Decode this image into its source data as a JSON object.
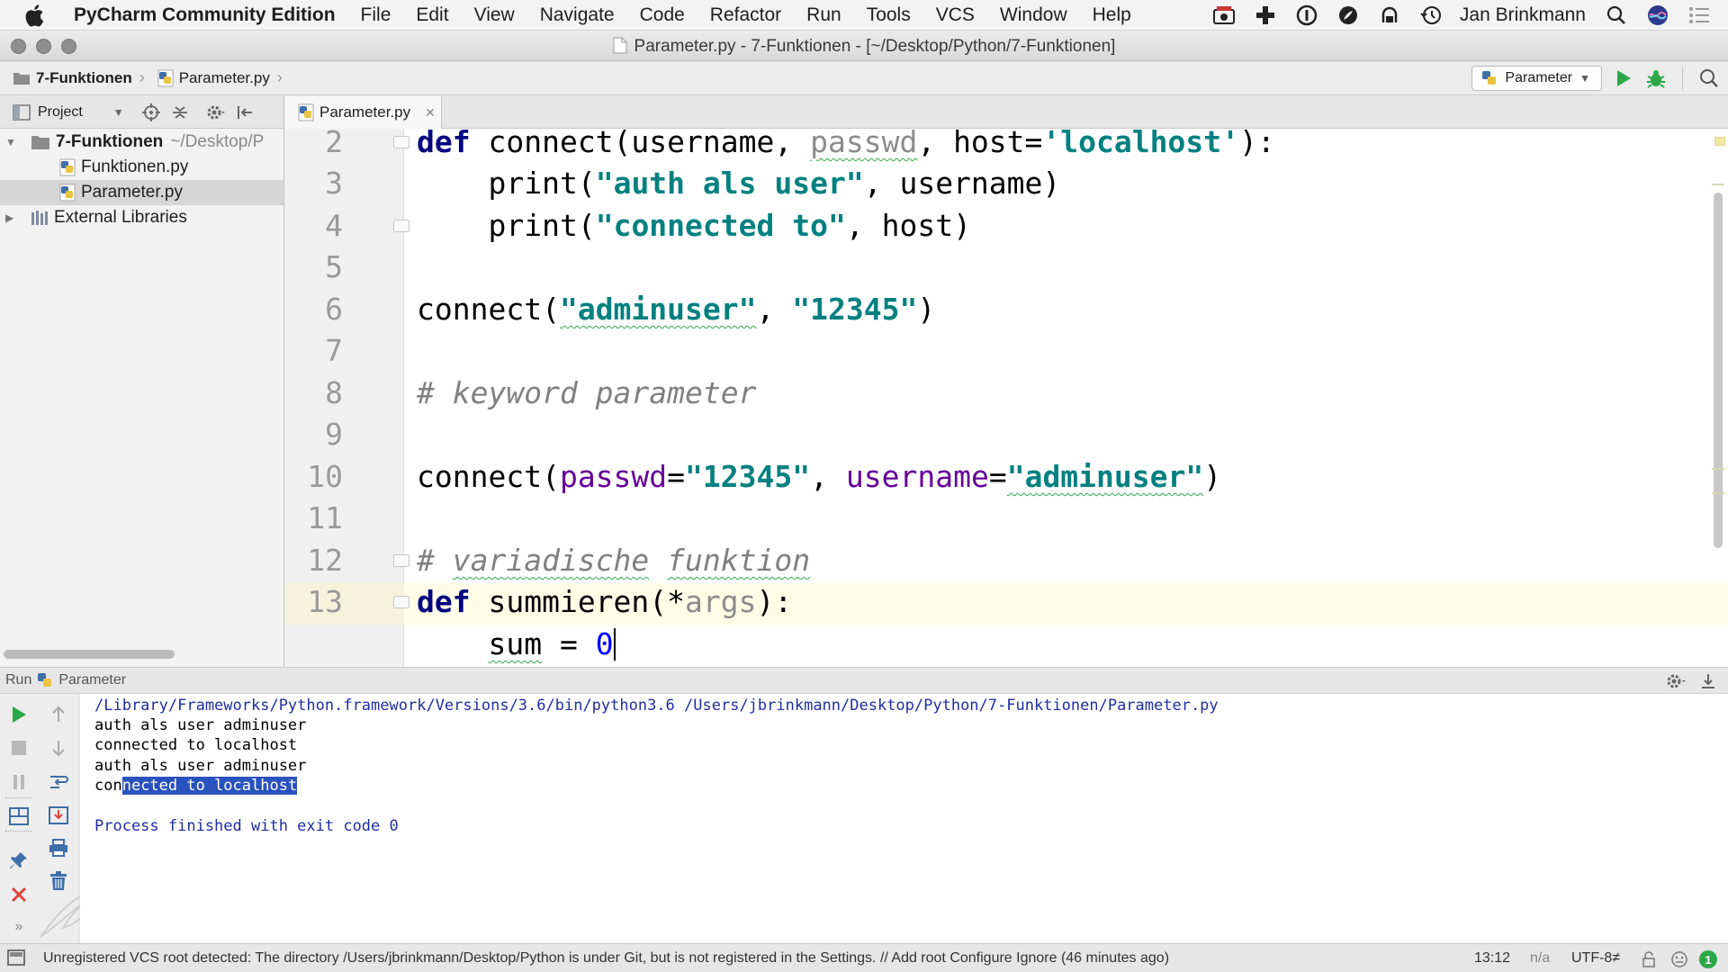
{
  "menubar": {
    "app_name": "PyCharm Community Edition",
    "items": [
      "File",
      "Edit",
      "View",
      "Navigate",
      "Code",
      "Refactor",
      "Run",
      "Tools",
      "VCS",
      "Window",
      "Help"
    ],
    "user": "Jan Brinkmann"
  },
  "window": {
    "title": "Parameter.py - 7-Funktionen - [~/Desktop/Python/7-Funktionen]"
  },
  "navbar": {
    "crumb_folder": "7-Funktionen",
    "crumb_file": "Parameter.py",
    "run_config": "Parameter"
  },
  "project": {
    "header_label": "Project",
    "tree": {
      "root_name": "7-Funktionen",
      "root_path": "~/Desktop/P",
      "file1": "Funktionen.py",
      "file2": "Parameter.py",
      "external": "External Libraries"
    }
  },
  "editor": {
    "tab_label": "Parameter.py",
    "line_numbers": [
      "2",
      "3",
      "4",
      "5",
      "6",
      "7",
      "8",
      "9",
      "10",
      "11",
      "12",
      "13"
    ],
    "code": {
      "l2_def": "def",
      "l2_fn": " connect(username, ",
      "l2_passwd": "passwd",
      "l2_mid": ", host=",
      "l2_str": "'localhost'",
      "l2_end": "):",
      "l3_indent": "    ",
      "l3_fn": "print(",
      "l3_str": "\"auth als user\"",
      "l3_end": ", username)",
      "l4_indent": "    ",
      "l4_fn": "print(",
      "l4_str": "\"connected to\"",
      "l4_end": ", host)",
      "l6_fn": "connect(",
      "l6_str1": "\"adminuser\"",
      "l6_sep": ", ",
      "l6_str2": "\"12345\"",
      "l6_end": ")",
      "l8_comment": "# keyword parameter",
      "l9_fn": "connect(",
      "l9_p1": "passwd",
      "l9_eq1": "=",
      "l9_s1": "\"12345\"",
      "l9_sep": ", ",
      "l9_p2": "username",
      "l9_eq2": "=",
      "l9_s2": "\"adminuser\"",
      "l9_end": ")",
      "l11_hash": "# ",
      "l11_w1": "variadische",
      "l11_sp": " ",
      "l11_w2": "funktion",
      "l12_def": "def",
      "l12_fn": " summieren(*",
      "l12_args": "args",
      "l12_end": "):",
      "l13_indent": "    ",
      "l13_var": "sum",
      "l13_eq": " = ",
      "l13_num": "0"
    }
  },
  "run": {
    "tab_label": "Run",
    "config_label": "Parameter",
    "console": {
      "line1": "/Library/Frameworks/Python.framework/Versions/3.6/bin/python3.6 /Users/jbrinkmann/Desktop/Python/7-Funktionen/Parameter.py",
      "line2": "auth als user adminuser",
      "line3": "connected to localhost",
      "line4": "auth als user adminuser",
      "line5_pre": "con",
      "line5_sel": "nected to localhost",
      "line6": "Process finished with exit code 0"
    }
  },
  "status": {
    "message": "Unregistered VCS root detected: The directory /Users/jbrinkmann/Desktop/Python is under Git, but is not registered in the Settings. // Add root  Configure  Ignore (46 minutes ago)",
    "position": "13:12",
    "na": "n/a",
    "encoding": "UTF-8≠"
  },
  "colors": {
    "keyword": "#000080",
    "string": "#008080",
    "comment": "#808080",
    "param": "#660099",
    "number": "#0000ff",
    "selection": "#2a52be",
    "run_green": "#2ca84a",
    "stop_red": "#e0443e"
  }
}
